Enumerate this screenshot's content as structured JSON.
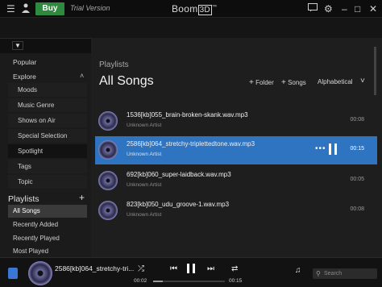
{
  "titlebar": {
    "buy_label": "Buy",
    "trial_label": "Trial Version",
    "brand_prefix": "Boom",
    "brand_box": "3D",
    "brand_tm": "™"
  },
  "sidebar": {
    "top_items": [
      "Popular",
      "Explore"
    ],
    "explore_items": [
      "Moods",
      "Music Genre",
      "Shows on Air",
      "Special Selection",
      "Spotlight",
      "Tags",
      "Topic"
    ],
    "playlists_heading": "Playlists",
    "playlists": [
      "All Songs",
      "Recently Added",
      "Recently Played",
      "Most Played"
    ],
    "active_playlist": "All Songs"
  },
  "main": {
    "breadcrumb": "Playlists",
    "title": "All Songs",
    "add_folder": "Folder",
    "add_songs": "Songs",
    "sort": "Alphabetical",
    "tracks": [
      {
        "name": "1536[kb]055_brain-broken-skank.wav.mp3",
        "artist": "Unknown Artist",
        "duration": "00:08"
      },
      {
        "name": "2586[kb]064_stretchy-triplettedtone.wav.mp3",
        "artist": "Unknown Artist",
        "duration": "00:15"
      },
      {
        "name": "692[kb]060_super-laidback.wav.mp3",
        "artist": "Unknown Artist",
        "duration": "00:05"
      },
      {
        "name": "823[kb]050_udu_groove-1.wav.mp3",
        "artist": "Unknown Artist",
        "duration": "00:08"
      }
    ],
    "playing_index": 1
  },
  "player": {
    "now_playing": "2586[kb]064_stretchy-tri...",
    "elapsed": "00:02",
    "total": "00:15",
    "progress_fraction": 0.13,
    "search_placeholder": "Search"
  },
  "colors": {
    "accent": "#2f74c0",
    "buy": "#2d8a3e"
  }
}
